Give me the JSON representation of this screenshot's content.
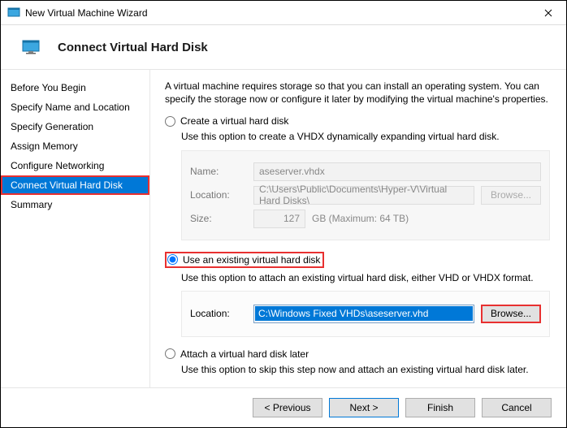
{
  "title": "New Virtual Machine Wizard",
  "header_title": "Connect Virtual Hard Disk",
  "sidebar": {
    "steps": [
      {
        "label": "Before You Begin"
      },
      {
        "label": "Specify Name and Location"
      },
      {
        "label": "Specify Generation"
      },
      {
        "label": "Assign Memory"
      },
      {
        "label": "Configure Networking"
      },
      {
        "label": "Connect Virtual Hard Disk"
      },
      {
        "label": "Summary"
      }
    ]
  },
  "intro": "A virtual machine requires storage so that you can install an operating system. You can specify the storage now or configure it later by modifying the virtual machine's properties.",
  "opt_create": {
    "label": "Create a virtual hard disk",
    "desc": "Use this option to create a VHDX dynamically expanding virtual hard disk.",
    "name_label": "Name:",
    "name_value": "aseserver.vhdx",
    "loc_label": "Location:",
    "loc_value": "C:\\Users\\Public\\Documents\\Hyper-V\\Virtual Hard Disks\\",
    "browse_label": "Browse...",
    "size_label": "Size:",
    "size_value": "127",
    "size_unit": "GB (Maximum: 64 TB)"
  },
  "opt_existing": {
    "label": "Use an existing virtual hard disk",
    "desc": "Use this option to attach an existing virtual hard disk, either VHD or VHDX format.",
    "loc_label": "Location:",
    "loc_value": "C:\\Windows Fixed VHDs\\aseserver.vhd",
    "browse_label": "Browse..."
  },
  "opt_later": {
    "label": "Attach a virtual hard disk later",
    "desc": "Use this option to skip this step now and attach an existing virtual hard disk later."
  },
  "buttons": {
    "previous": "< Previous",
    "next": "Next >",
    "finish": "Finish",
    "cancel": "Cancel"
  }
}
